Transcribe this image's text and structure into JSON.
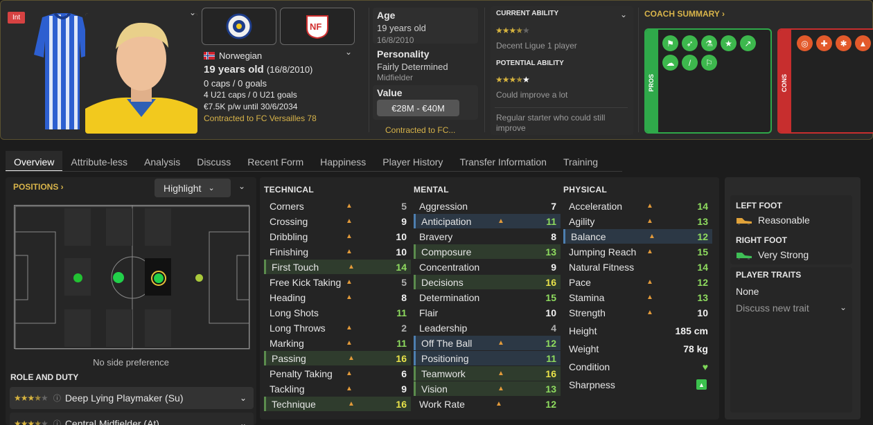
{
  "header": {
    "int_badge": "Int",
    "nationality": "Norwegian",
    "age_line": "19 years old",
    "dob": "(16/8/2010)",
    "caps": "0 caps / 0 goals",
    "u21": "4 U21 caps / 0 U21 goals",
    "wage": "€7.5K p/w until 30/6/2034",
    "contract": "Contracted to FC Versailles 78"
  },
  "info": {
    "age_label": "Age",
    "age_value": "19 years old",
    "age_dob": "16/8/2010",
    "personality_label": "Personality",
    "personality_value": "Fairly Determined",
    "position": "Midfielder",
    "value_label": "Value",
    "value_range": "€28M - €40M",
    "contracted_short": "Contracted to FC..."
  },
  "ability": {
    "current_label": "CURRENT ABILITY",
    "current_stars": 3.5,
    "current_text": "Decent Ligue 1 player",
    "potential_label": "POTENTIAL ABILITY",
    "potential_stars": 3.5,
    "potential_text": "Could improve a lot",
    "summary": "Regular starter who could still improve"
  },
  "coach": {
    "title": "COACH SUMMARY ›",
    "pros_label": "PROS",
    "cons_label": "CONS"
  },
  "tabs": [
    "Overview",
    "Attribute-less",
    "Analysis",
    "Discuss",
    "Recent Form",
    "Happiness",
    "Player History",
    "Transfer Information",
    "Training"
  ],
  "positions": {
    "title": "POSITIONS ›",
    "highlight": "Highlight",
    "side_pref": "No side preference"
  },
  "role": {
    "title": "ROLE AND DUTY",
    "role1": "Deep Lying Playmaker (Su)",
    "role2": "Central Midfielder (At)"
  },
  "technical": {
    "title": "TECHNICAL",
    "rows": [
      {
        "name": "Corners",
        "value": "5"
      },
      {
        "name": "Crossing",
        "value": "9"
      },
      {
        "name": "Dribbling",
        "value": "10"
      },
      {
        "name": "Finishing",
        "value": "10"
      },
      {
        "name": "First Touch",
        "value": "14"
      },
      {
        "name": "Free Kick Taking",
        "value": "5"
      },
      {
        "name": "Heading",
        "value": "8"
      },
      {
        "name": "Long Shots",
        "value": "11"
      },
      {
        "name": "Long Throws",
        "value": "2"
      },
      {
        "name": "Marking",
        "value": "11"
      },
      {
        "name": "Passing",
        "value": "16"
      },
      {
        "name": "Penalty Taking",
        "value": "6"
      },
      {
        "name": "Tackling",
        "value": "9"
      },
      {
        "name": "Technique",
        "value": "16"
      }
    ]
  },
  "mental": {
    "title": "MENTAL",
    "rows": [
      {
        "name": "Aggression",
        "value": "7"
      },
      {
        "name": "Anticipation",
        "value": "11"
      },
      {
        "name": "Bravery",
        "value": "8"
      },
      {
        "name": "Composure",
        "value": "13"
      },
      {
        "name": "Concentration",
        "value": "9"
      },
      {
        "name": "Decisions",
        "value": "16"
      },
      {
        "name": "Determination",
        "value": "15"
      },
      {
        "name": "Flair",
        "value": "10"
      },
      {
        "name": "Leadership",
        "value": "4"
      },
      {
        "name": "Off The Ball",
        "value": "12"
      },
      {
        "name": "Positioning",
        "value": "11"
      },
      {
        "name": "Teamwork",
        "value": "16"
      },
      {
        "name": "Vision",
        "value": "13"
      },
      {
        "name": "Work Rate",
        "value": "12"
      }
    ]
  },
  "physical": {
    "title": "PHYSICAL",
    "rows": [
      {
        "name": "Acceleration",
        "value": "14"
      },
      {
        "name": "Agility",
        "value": "13"
      },
      {
        "name": "Balance",
        "value": "12"
      },
      {
        "name": "Jumping Reach",
        "value": "15"
      },
      {
        "name": "Natural Fitness",
        "value": "14"
      },
      {
        "name": "Pace",
        "value": "12"
      },
      {
        "name": "Stamina",
        "value": "13"
      },
      {
        "name": "Strength",
        "value": "10"
      }
    ],
    "height_label": "Height",
    "height": "185 cm",
    "weight_label": "Weight",
    "weight": "78 kg",
    "condition_label": "Condition",
    "sharpness_label": "Sharpness"
  },
  "feet": {
    "left_title": "LEFT FOOT",
    "left_value": "Reasonable",
    "right_title": "RIGHT FOOT",
    "right_value": "Very Strong",
    "traits_title": "PLAYER TRAITS",
    "traits_value": "None",
    "discuss": "Discuss new trait"
  },
  "colors": {
    "gold": "#d8b44a",
    "green_value": "#8fdc5f",
    "yellow_value": "#e9e34a",
    "pros": "#2fa94a",
    "cons": "#c72e2e"
  }
}
